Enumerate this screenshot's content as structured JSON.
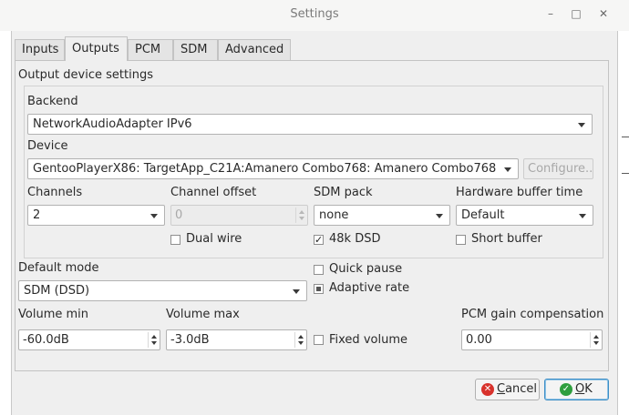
{
  "window": {
    "title": "Settings",
    "minimize_glyph": "–",
    "maximize_glyph": "□",
    "close_glyph": "✕"
  },
  "tabs": [
    {
      "label": "Inputs",
      "active": false
    },
    {
      "label": "Outputs",
      "active": true
    },
    {
      "label": "PCM",
      "active": false
    },
    {
      "label": "SDM",
      "active": false
    },
    {
      "label": "Advanced",
      "active": false
    }
  ],
  "output_device": {
    "group_title": "Output device settings",
    "backend_label": "Backend",
    "backend_value": "NetworkAudioAdapter IPv6",
    "device_label": "Device",
    "device_value": "GentooPlayerX86: TargetApp_C21A:Amanero Combo768: Amanero Combo768",
    "configure_label": "Configure...",
    "channels_label": "Channels",
    "channels_value": "2",
    "channel_offset_label": "Channel offset",
    "channel_offset_value": "0",
    "sdm_pack_label": "SDM pack",
    "sdm_pack_value": "none",
    "hw_buffer_label": "Hardware buffer time",
    "hw_buffer_value": "Default",
    "dual_wire_label": "Dual wire",
    "dual_wire_checked": false,
    "dsd48k_label": "48k DSD",
    "dsd48k_checked": true,
    "short_buffer_label": "Short buffer",
    "short_buffer_checked": false
  },
  "general": {
    "default_mode_label": "Default mode",
    "default_mode_value": "SDM (DSD)",
    "quick_pause_label": "Quick pause",
    "quick_pause_checked": false,
    "adaptive_rate_label": "Adaptive rate",
    "adaptive_rate_state": "partial",
    "volume_min_label": "Volume min",
    "volume_min_value": "-60.0dB",
    "volume_max_label": "Volume max",
    "volume_max_value": "-3.0dB",
    "fixed_volume_label": "Fixed volume",
    "fixed_volume_checked": false,
    "pcm_gain_label": "PCM gain compensation",
    "pcm_gain_value": "0.00"
  },
  "buttons": {
    "cancel_prefix": "",
    "cancel_underline": "C",
    "cancel_rest": "ancel",
    "ok_underline": "O",
    "ok_rest": "K",
    "check_glyph": "✓",
    "cancel_glyph": "✕"
  },
  "colors": {
    "ok_icon": "#2e9e3e",
    "cancel_icon": "#d8322c",
    "focus_border": "#3c8ec6"
  }
}
